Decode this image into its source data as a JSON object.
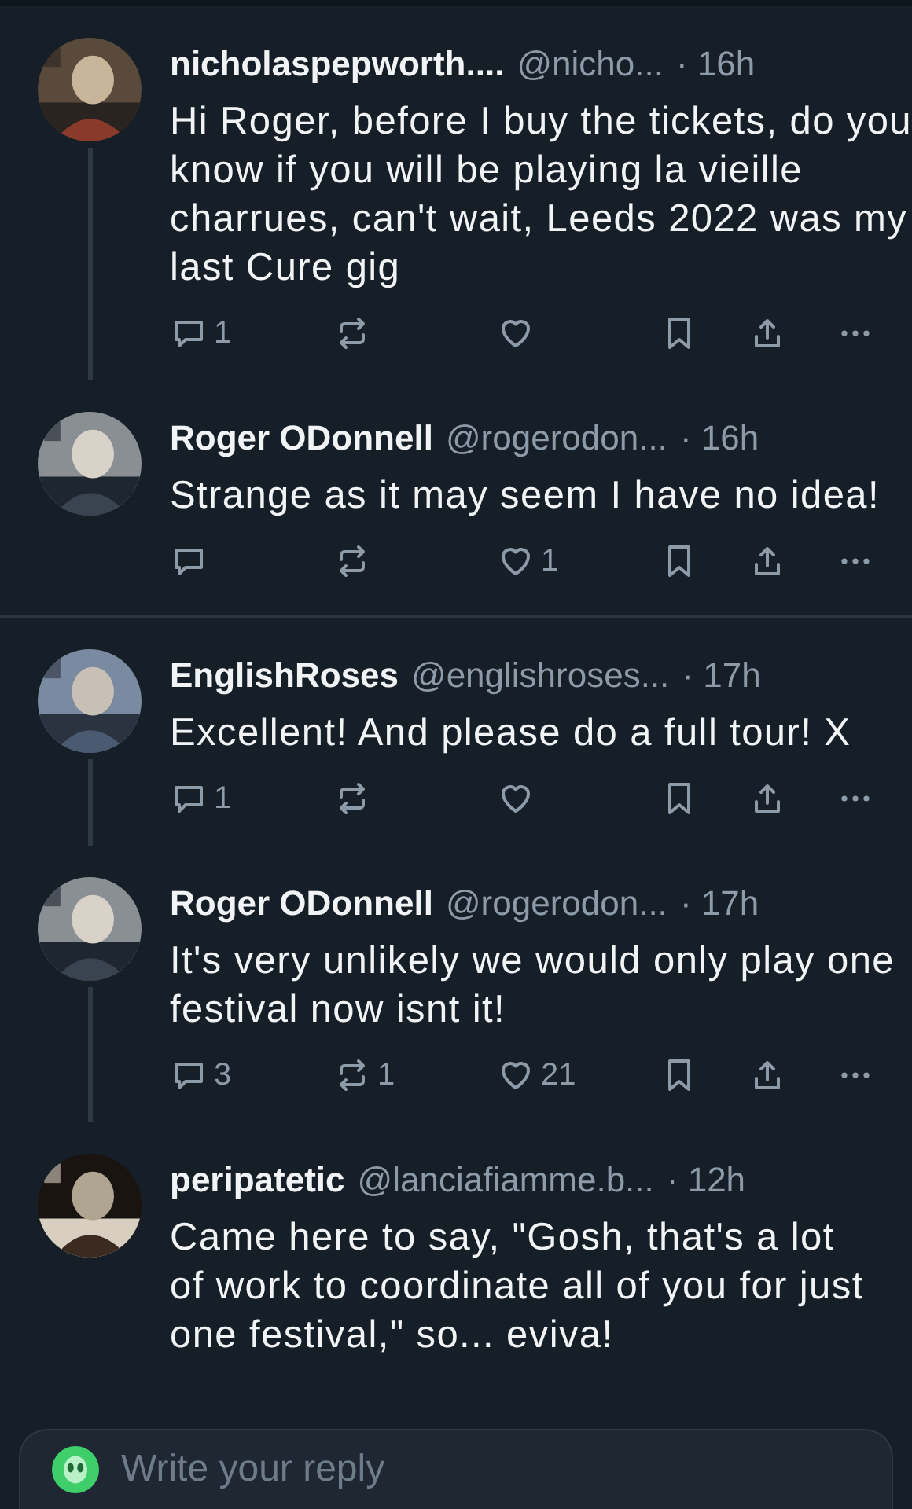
{
  "posts": [
    {
      "name": "nicholaspepworth....",
      "handle": "@nicho...",
      "time": "· 16h",
      "text": "Hi Roger, before I buy the tickets, do you know if you will be playing la vieille charrues, can't wait, Leeds 2022 was my last Cure gig",
      "replies": "1",
      "thread_below": true,
      "divider_below": false
    },
    {
      "name": "Roger ODonnell",
      "handle": "@rogerodon...",
      "time": "· 16h",
      "text": "Strange as it may seem I have no idea!",
      "likes": "1",
      "thread_below": false,
      "divider_below": true
    },
    {
      "name": "EnglishRoses",
      "handle": "@englishroses...",
      "time": "· 17h",
      "text": "Excellent! And please do a full tour! X",
      "replies": "1",
      "thread_below": true,
      "divider_below": false
    },
    {
      "name": "Roger ODonnell",
      "handle": "@rogerodon...",
      "time": "· 17h",
      "text": "It's very unlikely we would only play one festival now isnt it!",
      "replies": "3",
      "reposts": "1",
      "likes": "21",
      "thread_below": true,
      "divider_below": false
    },
    {
      "name": "peripatetic",
      "handle": "@lanciafiamme.b...",
      "time": "· 12h",
      "text": "Came here to say, \"Gosh, that's a lot of work to coordinate all of you for just one festival,\" so... eviva!",
      "thread_below": false,
      "divider_below": false
    }
  ],
  "reply_bar": {
    "placeholder": "Write your reply"
  }
}
